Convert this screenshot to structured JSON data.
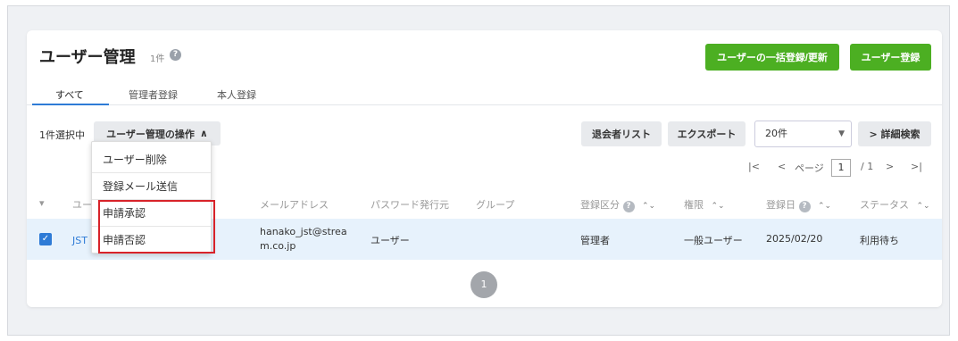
{
  "page": {
    "title": "ユーザー管理",
    "count": "1件",
    "help_icon": "?"
  },
  "actions": {
    "bulk_register": "ユーザーの一括登録/更新",
    "register": "ユーザー登録"
  },
  "tabs": [
    {
      "label": "すべて",
      "active": true
    },
    {
      "label": "管理者登録",
      "active": false
    },
    {
      "label": "本人登録",
      "active": false
    }
  ],
  "toolbar": {
    "selected_text": "1件選択中",
    "operations_label": "ユーザー管理の操作",
    "operations_caret": "∧",
    "withdrawn_list": "退会者リスト",
    "export": "エクスポート",
    "page_size": "20件",
    "page_size_caret": "▼",
    "advanced_search": "> 詳細検索"
  },
  "pager": {
    "first": "|<",
    "prev": "<",
    "page_label": "ページ",
    "current": "1",
    "total": "/ 1",
    "next": ">",
    "last": ">|"
  },
  "table": {
    "select_all_caret": "▾",
    "headers": {
      "user": "ユーザ",
      "email": "メールアドレス",
      "password_issuer": "パスワード発行元",
      "group": "グループ",
      "registration_type": "登録区分",
      "role": "権限",
      "registered_date": "登録日",
      "status": "ステータス"
    },
    "sort_icon": "⌃⌄",
    "rows": [
      {
        "checked": "✓",
        "user": "JST 花",
        "email_line1": "hanako_jst@strea",
        "email_line2": "m.co.jp",
        "password_issuer": "ユーザー",
        "group": "",
        "registration_type": "管理者",
        "role": "一般ユーザー",
        "registered_date": "2025/02/20",
        "status": "利用待ち"
      }
    ]
  },
  "pagination": {
    "current_page": "1"
  },
  "dropdown_menu": {
    "items": [
      "ユーザー削除",
      "登録メール送信",
      "申請承認",
      "申請否認"
    ]
  },
  "colors": {
    "primary_green": "#4caf22",
    "accent_blue": "#2e7bd6",
    "highlight_red": "#d8232a",
    "selected_row": "#e7f2fc"
  }
}
